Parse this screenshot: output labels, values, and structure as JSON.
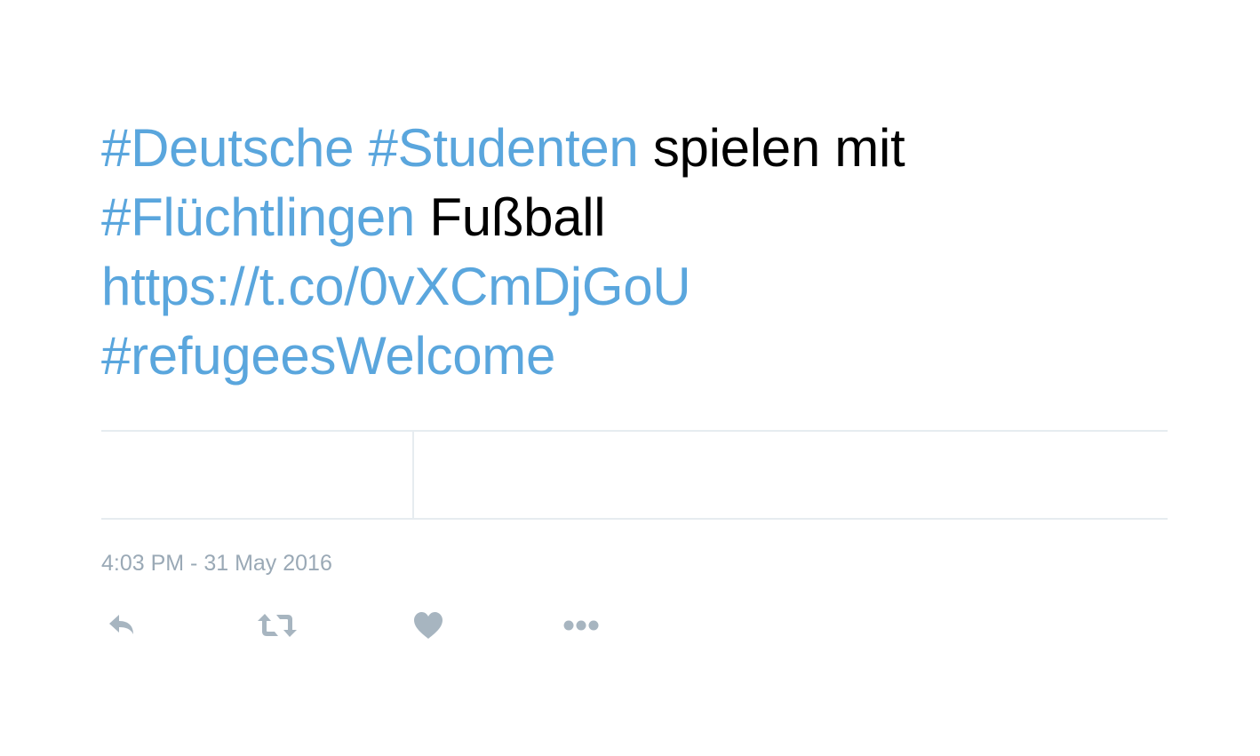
{
  "tweet": {
    "text_lines": [
      [
        {
          "text": "#Deutsche",
          "kind": "hashtag"
        },
        {
          "text": " ",
          "kind": "plain"
        },
        {
          "text": "#Studenten",
          "kind": "hashtag"
        },
        {
          "text": " spielen mit",
          "kind": "plain"
        }
      ],
      [
        {
          "text": "#Flüchtlingen",
          "kind": "hashtag"
        },
        {
          "text": " Fußball",
          "kind": "plain"
        }
      ],
      [
        {
          "text": "https://t.co/0vXCmDjGoU",
          "kind": "link"
        }
      ],
      [
        {
          "text": "#refugeesWelcome",
          "kind": "hashtag"
        }
      ]
    ],
    "timestamp": "4:03 PM - 31 May 2016"
  },
  "actions": [
    {
      "name": "reply",
      "icon": "reply-icon"
    },
    {
      "name": "retweet",
      "icon": "retweet-icon"
    },
    {
      "name": "like",
      "icon": "heart-icon"
    },
    {
      "name": "more",
      "icon": "more-icon"
    }
  ],
  "colors": {
    "link": "#5aa6dd",
    "text": "#000000",
    "muted": "#9aa9b6",
    "icon": "#a7b5c0",
    "divider": "#e6ecf0"
  }
}
